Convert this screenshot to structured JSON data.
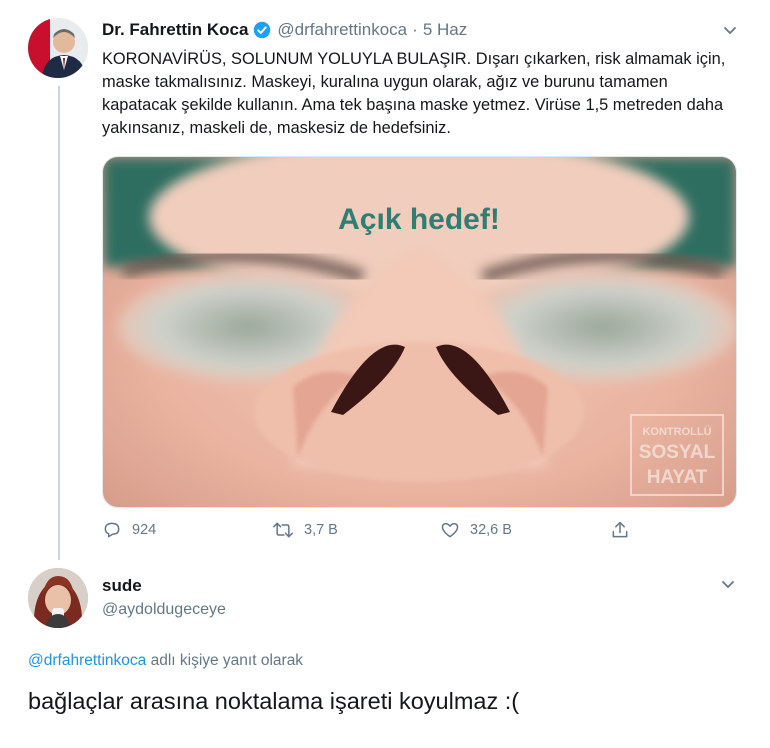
{
  "tweet": {
    "author_name": "Dr. Fahrettin Koca",
    "handle": "@drfahrettinkoca",
    "separator": "·",
    "date": "5 Haz",
    "text": "KORONAVİRÜS, SOLUNUM YOLUYLA BULAŞIR. Dışarı çıkarken, risk almamak için, maske takmalısınız. Maskeyi, kuralına uygun olarak, ağız ve burunu tamamen kapatacak şekilde kullanın. Ama tek başına maske yetmez. Virüse 1,5 metreden daha yakınsanız, maskeli de, maskesiz de hedefsiniz.",
    "image": {
      "headline": "Açık hedef!",
      "watermark_line1": "KONTROLLÜ",
      "watermark_line2": "SOSYAL",
      "watermark_line3": "HAYAT"
    },
    "actions": {
      "replies": "924",
      "retweets": "3,7 B",
      "likes": "32,6 B"
    },
    "colors": {
      "accent": "#1da1f2",
      "muted": "#657786",
      "headline": "#2e7e74"
    }
  },
  "reply": {
    "author_name": "sude",
    "handle": "@aydoldugeceye",
    "reply_to_handle": "@drfahrettinkoca",
    "reply_to_suffix": " adlı kişiye yanıt olarak",
    "text": "bağlaçlar arasına noktalama işareti koyulmaz :("
  },
  "icons": [
    "verified-badge-icon",
    "chevron-down-icon",
    "reply-icon",
    "retweet-icon",
    "like-icon",
    "share-icon"
  ]
}
